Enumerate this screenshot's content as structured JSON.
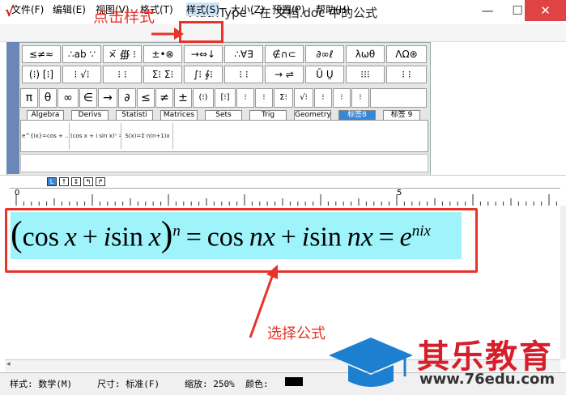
{
  "window": {
    "title": "MathType - 在 文档.doc 中的公式",
    "logo_glyph": "√",
    "min_glyph": "—",
    "max_glyph": "☐",
    "close_glyph": "✕"
  },
  "menu": [
    "文件(F)",
    "编辑(E)",
    "视图(V)",
    "格式(T)",
    "样式(S)",
    "大小(Z)",
    "预置(P)",
    "帮助(H)"
  ],
  "palette": {
    "row1": [
      "≤≠≈",
      "∴ab ∵",
      "⨯̈ ∰ ⁝",
      "±•⊗",
      "→⇔↓",
      "∴∀∃",
      "∉∩⊂",
      "∂∞ℓ",
      "λωθ",
      "ΛΩ⊛"
    ],
    "row2": [
      "(⁝) [⁝]",
      "⁝ √⁝",
      "⁝ ⁝",
      "Σ⁝ Σ⁝",
      "∫⁝ ∮⁝",
      "⁝ ⁝",
      "→ ⇌",
      "Ū Ṳ",
      "⁝⁝⁝",
      "⁝ ⁝"
    ],
    "row3": [
      "π",
      "θ",
      "∞",
      "∈",
      "→",
      "∂",
      "≤",
      "≠",
      "±",
      "(⁝)",
      "[⁝]",
      "⁝",
      "Σ⁝",
      "√⁝",
      "⁝",
      "⁝",
      "⁝"
    ],
    "tabs": [
      "Algebra",
      "Derivs",
      "Statisti",
      "Matrices",
      "Sets",
      "Trig",
      "Geometry",
      "标签8",
      "标签 9"
    ],
    "saved": [
      "e^{ix}=cos + ...",
      "(cos x + i sin x)ⁿ = cos",
      "S(x)=Σ n(n+1)x"
    ]
  },
  "size_buttons": [
    "L",
    "↑",
    "↕",
    "↰",
    "↱"
  ],
  "ruler": {
    "tick_0": "0",
    "tick_5": "5"
  },
  "formula": {
    "lparen": "(",
    "cos1": "cos",
    "x1": "x",
    "plus1": "+",
    "i1": "i",
    "sin1": "sin",
    "x2": "x",
    "rparen": ")",
    "n_exp": "n",
    "eq1": "=",
    "cos2": "cos",
    "nx1": "nx",
    "plus2": "+",
    "i2": "i",
    "sin2": "sin",
    "nx2": "nx",
    "eq2": "=",
    "e": "e",
    "nix_exp": "nix"
  },
  "annotations": {
    "click_style": "点击样式",
    "select_formula": "选择公式"
  },
  "status": {
    "style": "样式: 数学(M)",
    "size": "尺寸: 标准(F)",
    "zoom": "缩放: 250%",
    "color": "颜色:"
  },
  "watermark": {
    "name": "其乐教育",
    "url": "www.76edu.com"
  },
  "colors": {
    "annotation_red": "#e7332a",
    "formula_highlight": "#9ff4fb",
    "active_tab": "#3a86d6"
  }
}
